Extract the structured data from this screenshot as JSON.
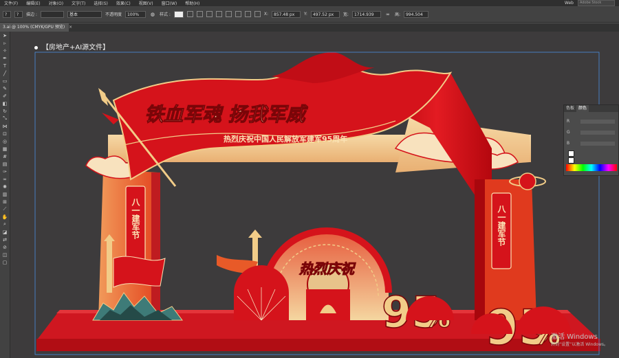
{
  "menu": {
    "items": [
      "文件(F)",
      "编辑(E)",
      "对象(O)",
      "文字(T)",
      "选择(S)",
      "效果(C)",
      "视图(V)",
      "窗口(W)",
      "帮助(H)"
    ],
    "workspace": "Web",
    "search_placeholder": "Adobe Stock"
  },
  "control_bar": {
    "stroke_label": "描边 :",
    "brush_label": "基本",
    "opacity_label": "不透明度",
    "opacity_value": "100%",
    "style_label": "样式 :",
    "x_label": "X:",
    "x_value": "857.48 px",
    "y_label": "Y:",
    "y_value": "497.52 px",
    "w_label": "宽:",
    "w_value": "1714.939",
    "h_label": "高:",
    "h_value": "994.504"
  },
  "document": {
    "tab_label": "3.ai @ 100% (CMYK/GPU 预览)",
    "close_symbol": "×"
  },
  "canvas": {
    "caption": "【房地产+AI源文件】"
  },
  "artwork": {
    "banner_title": "铁血军魂 扬我军威",
    "banner_subtitle": "热烈庆祝中国人民解放军建军95周年",
    "left_pillar_text": "八一建军节",
    "right_pillar_text": "八一建军节",
    "center_badge": "热烈庆祝",
    "number_95": "95",
    "percent_mark": "%"
  },
  "color_panel": {
    "tab_swatches": "色板",
    "tab_color": "颜色",
    "channels": [
      "R",
      "G",
      "B"
    ]
  },
  "watermark": {
    "line1": "激活 Windows",
    "line2": "转到“设置”以激活 Windows。"
  },
  "colors": {
    "brand_red": "#d5131b",
    "dark_red": "#a8070d",
    "gold": "#f2cc88",
    "cream": "#fbe3b5"
  }
}
